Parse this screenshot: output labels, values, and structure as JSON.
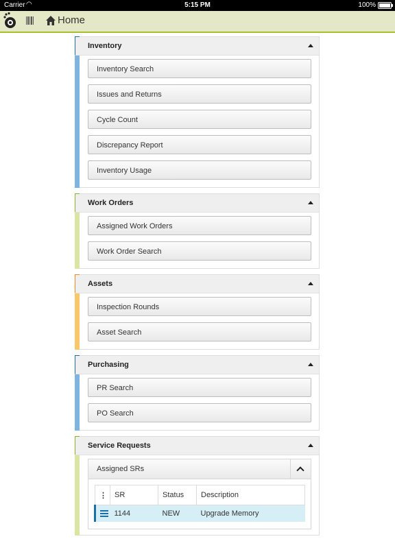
{
  "status_bar": {
    "carrier": "Carrier",
    "time": "5:15 PM",
    "battery": "100%"
  },
  "header": {
    "title": "Home"
  },
  "colors": {
    "blue": "#1b6fa8",
    "light_blue": "#7fb4e0",
    "green": "#8cb12b",
    "light_green": "#d8e5a3",
    "orange": "#f08c1c",
    "light_orange": "#f9c66a"
  },
  "panels": [
    {
      "title": "Inventory",
      "buttons": [
        "Inventory Search",
        "Issues and Returns",
        "Cycle Count",
        "Discrepancy Report",
        "Inventory Usage"
      ]
    },
    {
      "title": "Work Orders",
      "buttons": [
        "Assigned Work Orders",
        "Work Order Search"
      ]
    },
    {
      "title": "Assets",
      "buttons": [
        "Inspection Rounds",
        "Asset Search"
      ]
    },
    {
      "title": "Purchasing",
      "buttons": [
        "PR Search",
        "PO Search"
      ]
    },
    {
      "title": "Service Requests",
      "subpanel": {
        "title": "Assigned SRs",
        "columns": [
          "SR",
          "Status",
          "Description"
        ],
        "rows": [
          {
            "sr": "1144",
            "status": "NEW",
            "description": "Upgrade Memory"
          }
        ]
      }
    }
  ]
}
